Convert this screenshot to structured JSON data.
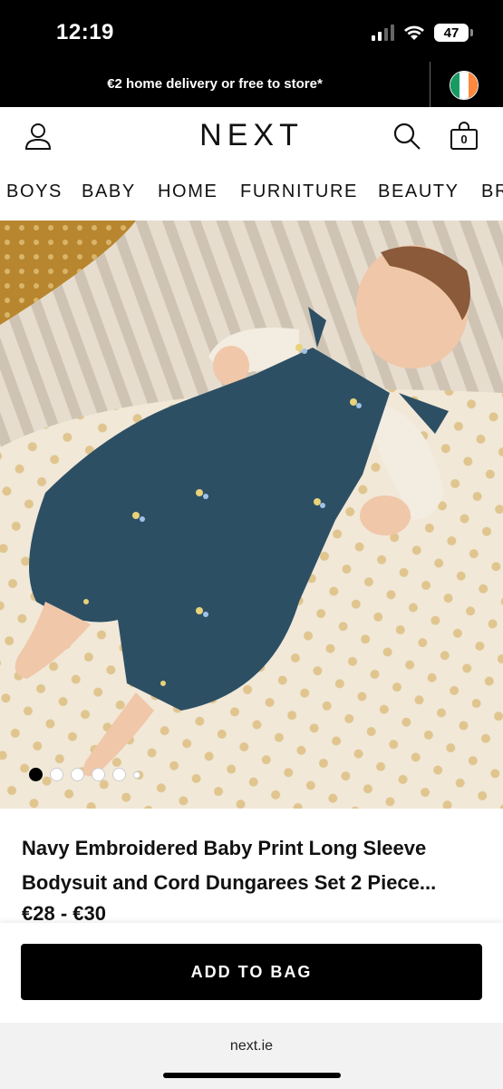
{
  "status_bar": {
    "time": "12:19",
    "battery": "47"
  },
  "promo": {
    "text": "€2 home delivery or free to store*",
    "flag_colors": [
      "#169b62",
      "#ffffff",
      "#ff883e"
    ]
  },
  "header": {
    "logo": "NEXT",
    "bag_count": "0",
    "icons": [
      "account-icon",
      "search-icon",
      "shopping-bag-icon"
    ]
  },
  "nav": {
    "items": [
      "BOYS",
      "BABY",
      "HOME",
      "FURNITURE",
      "BEAUTY",
      "BR"
    ]
  },
  "gallery": {
    "current_index": 1,
    "dot_count": 6
  },
  "product": {
    "title_line1": "Navy Embroidered Baby Print Long Sleeve",
    "title_line2": "Bodysuit and Cord Dungarees Set 2 Piece...",
    "price": "€28 - €30"
  },
  "actions": {
    "add_to_bag": "ADD TO BAG"
  },
  "browser": {
    "url": "next.ie"
  },
  "colors": {
    "brand_black": "#000000",
    "dungaree_navy": "#2d4f64"
  }
}
